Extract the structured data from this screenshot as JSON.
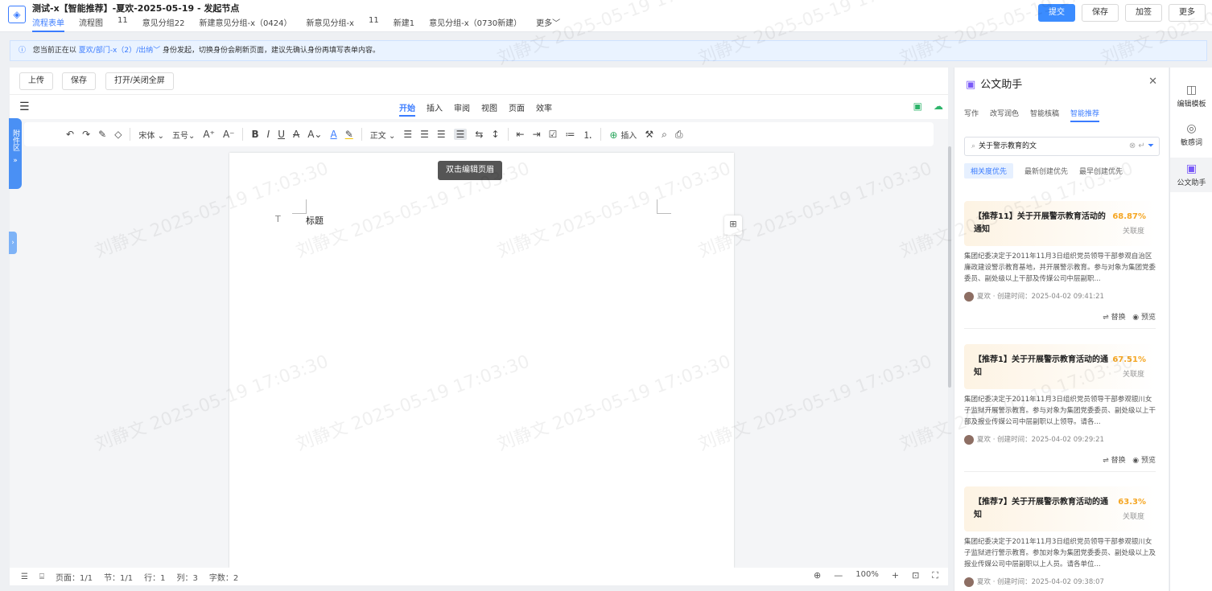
{
  "header": {
    "title": "测试-x【智能推荐】-夏欢-2025-05-19 - 发起节点",
    "tabs": [
      "流程表单",
      "流程图",
      "11",
      "意见分组22",
      "新建意见分组-x（0424）",
      "新意见分组-x",
      "11",
      "新建1",
      "意见分组-x（0730新建）",
      "更多"
    ],
    "actions": [
      "提交",
      "保存",
      "加签",
      "更多"
    ]
  },
  "notice": {
    "prefix": "您当前正在以",
    "identity": "夏欢/部门-x（2）/出纳",
    "suffix": "身份发起，切换身份会刷新页面，建议先确认身份再填写表单内容。"
  },
  "editor_toolbar": {
    "buttons": [
      "上传",
      "保存",
      "打开/关闭全屏"
    ]
  },
  "menubar": {
    "tabs": [
      "开始",
      "插入",
      "审阅",
      "视图",
      "页面",
      "效率"
    ],
    "active": "开始"
  },
  "format": {
    "font": "宋体",
    "size": "五号",
    "style": "正文",
    "insert": "插入"
  },
  "attach_tab": "附件区",
  "document": {
    "tooltip": "双击编辑页眉",
    "heading": "标题",
    "heading_mark": "T"
  },
  "status": {
    "page": "页面：1/1",
    "section": "节：1/1",
    "row": "行：1",
    "col": "列：3",
    "words": "字数：2",
    "zoom": "100%"
  },
  "assistant": {
    "title": "公文助手",
    "tabs": [
      "写作",
      "改写润色",
      "智能核稿",
      "智能推荐"
    ],
    "active_tab": "智能推荐",
    "search_value": "关于警示教育的文",
    "sorts": [
      "相关度优先",
      "最新创建优先",
      "最早创建优先"
    ],
    "cards": [
      {
        "title": "【推荐11】关于开展警示教育活动的通知",
        "score": "68.87%",
        "score_label": "关联度",
        "summary": "集团纪委决定于2011年11月3日组织党员领导干部参观自治区廉政建设警示教育基地，并开展警示教育。参与对象为集团党委委员、副处级以上干部及传媒公司中层副职...",
        "author": "夏欢",
        "created": "创建时间：2025-04-02 09:41:21",
        "replace": "替换",
        "preview": "预览"
      },
      {
        "title": "【推荐1】关于开展警示教育活动的通知",
        "score": "67.51%",
        "score_label": "关联度",
        "summary": "集团纪委决定于2011年11月3日组织党员领导干部参观银川女子监狱开展警示教育。参与对象为集团党委委员、副处级以上干部及报业传媒公司中层副职以上领导。请各...",
        "author": "夏欢",
        "created": "创建时间：2025-04-02 09:29:21",
        "replace": "替换",
        "preview": "预览"
      },
      {
        "title": "【推荐7】关于开展警示教育活动的通知",
        "score": "63.3%",
        "score_label": "关联度",
        "summary": "集团纪委决定于2011年11月3日组织党员领导干部参观银川女子监狱进行警示教育。参加对象为集团党委委员、副处级以上及报业传媒公司中层副职以上人员。请各单位...",
        "author": "夏欢",
        "created": "创建时间：2025-04-02 09:38:07",
        "replace": "替换",
        "preview": "预览"
      }
    ]
  },
  "rail": [
    "编辑模板",
    "敏感词",
    "公文助手"
  ],
  "watermark": {
    "name": "刘静文",
    "date": "2025-05-19",
    "time": "17:03:30"
  },
  "colors": {
    "accent": "#3b7cff",
    "score": "#f5a623",
    "assistant_icon": "#7a5af8"
  }
}
